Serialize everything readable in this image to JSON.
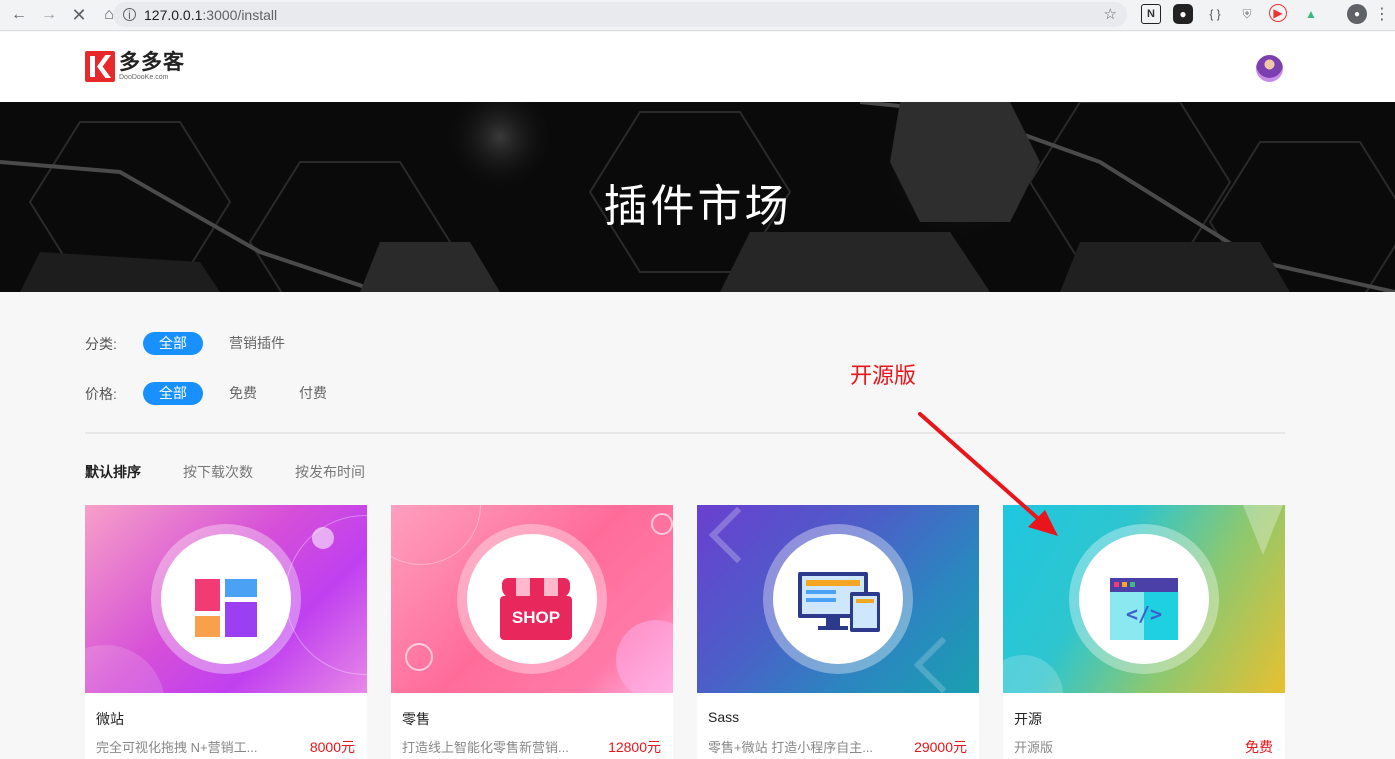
{
  "browser": {
    "url_host": "127.0.0.1",
    "url_rest": ":3000/install",
    "icons": [
      "back-icon",
      "forward-icon",
      "stop-icon",
      "home-icon",
      "info-icon",
      "star-icon"
    ]
  },
  "brand": {
    "name_cn": "多多客",
    "name_en": "DooDooKe.com"
  },
  "banner": {
    "title": "插件市场"
  },
  "filters": {
    "category": {
      "label": "分类:",
      "options": [
        "全部",
        "营销插件"
      ],
      "selected": "全部"
    },
    "price": {
      "label": "价格:",
      "options": [
        "全部",
        "免费",
        "付费"
      ],
      "selected": "全部"
    }
  },
  "sort": {
    "options": [
      "默认排序",
      "按下载次数",
      "按发布时间"
    ],
    "selected": "默认排序"
  },
  "annotation": {
    "text": "开源版"
  },
  "cards": [
    {
      "name": "微站",
      "desc": "完全可视化拖拽 N+营销工...",
      "price": "8000元"
    },
    {
      "name": "零售",
      "desc": "打造线上智能化零售新营销...",
      "price": "12800元"
    },
    {
      "name": "Sass",
      "desc": "零售+微站 打造小程序自主...",
      "price": "29000元"
    },
    {
      "name": "开源",
      "desc": "开源版",
      "price": "免费"
    }
  ],
  "colors": {
    "accent": "#1890ff",
    "price": "#e8161b",
    "annotation": "#e8161b"
  },
  "shop_label": "SHOP"
}
